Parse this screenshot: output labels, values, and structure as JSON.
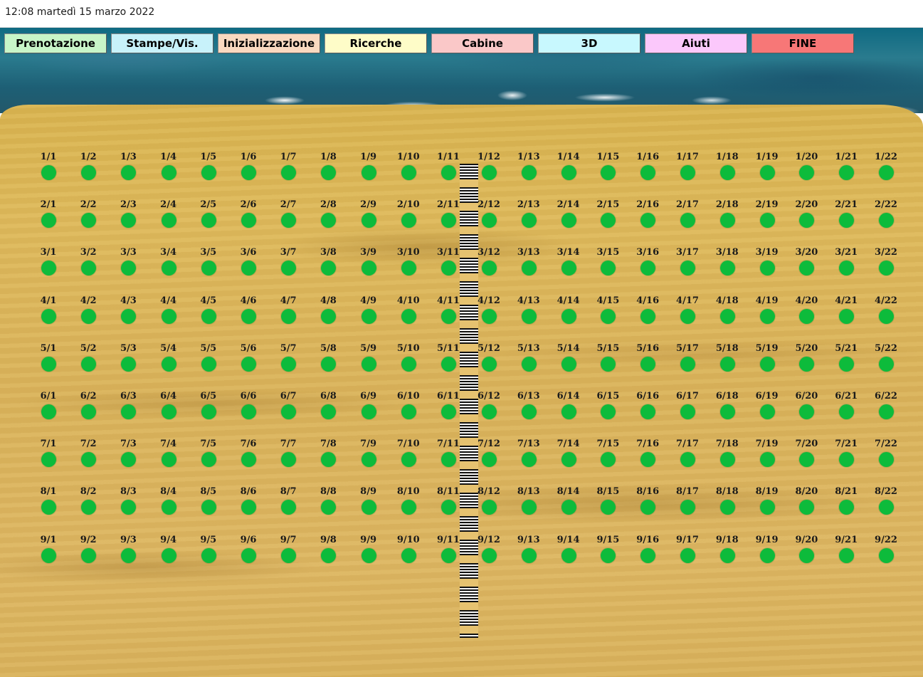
{
  "window": {
    "title": "12:08 martedì 15 marzo 2022"
  },
  "menu": [
    {
      "id": "prenotazione",
      "label": "Prenotazione",
      "color": "#c8f5c8"
    },
    {
      "id": "stampe",
      "label": "Stampe/Vis.",
      "color": "#c8f2fa"
    },
    {
      "id": "inizializzazione",
      "label": "Inizializzazione",
      "color": "#f9d9c0"
    },
    {
      "id": "ricerche",
      "label": "Ricerche",
      "color": "#fefcc8"
    },
    {
      "id": "cabine",
      "label": "Cabine",
      "color": "#fac8c8"
    },
    {
      "id": "3d",
      "label": "3D",
      "color": "#c8f8fe"
    },
    {
      "id": "aiuti",
      "label": "Aiuti",
      "color": "#fbc8fb"
    },
    {
      "id": "fine",
      "label": "FINE",
      "color": "#f77777"
    }
  ],
  "beach": {
    "rows": 9,
    "cols": 22,
    "spot_color": "#0dbb3b",
    "spots": [
      [
        "1/1",
        "1/2",
        "1/3",
        "1/4",
        "1/5",
        "1/6",
        "1/7",
        "1/8",
        "1/9",
        "1/10",
        "1/11",
        "1/12",
        "1/13",
        "1/14",
        "1/15",
        "1/16",
        "1/17",
        "1/18",
        "1/19",
        "1/20",
        "1/21",
        "1/22"
      ],
      [
        "2/1",
        "2/2",
        "2/3",
        "2/4",
        "2/5",
        "2/6",
        "2/7",
        "2/8",
        "2/9",
        "2/10",
        "2/11",
        "2/12",
        "2/13",
        "2/14",
        "2/15",
        "2/16",
        "2/17",
        "2/18",
        "2/19",
        "2/20",
        "2/21",
        "2/22"
      ],
      [
        "3/1",
        "3/2",
        "3/3",
        "3/4",
        "3/5",
        "3/6",
        "3/7",
        "3/8",
        "3/9",
        "3/10",
        "3/11",
        "3/12",
        "3/13",
        "3/14",
        "3/15",
        "3/16",
        "3/17",
        "3/18",
        "3/19",
        "3/20",
        "3/21",
        "3/22"
      ],
      [
        "4/1",
        "4/2",
        "4/3",
        "4/4",
        "4/5",
        "4/6",
        "4/7",
        "4/8",
        "4/9",
        "4/10",
        "4/11",
        "4/12",
        "4/13",
        "4/14",
        "4/15",
        "4/16",
        "4/17",
        "4/18",
        "4/19",
        "4/20",
        "4/21",
        "4/22"
      ],
      [
        "5/1",
        "5/2",
        "5/3",
        "5/4",
        "5/5",
        "5/6",
        "5/7",
        "5/8",
        "5/9",
        "5/10",
        "5/11",
        "5/12",
        "5/13",
        "5/14",
        "5/15",
        "5/16",
        "5/17",
        "5/18",
        "5/19",
        "5/20",
        "5/21",
        "5/22"
      ],
      [
        "6/1",
        "6/2",
        "6/3",
        "6/4",
        "6/5",
        "6/6",
        "6/7",
        "6/8",
        "6/9",
        "6/10",
        "6/11",
        "6/12",
        "6/13",
        "6/14",
        "6/15",
        "6/16",
        "6/17",
        "6/18",
        "6/19",
        "6/20",
        "6/21",
        "6/22"
      ],
      [
        "7/1",
        "7/2",
        "7/3",
        "7/4",
        "7/5",
        "7/6",
        "7/7",
        "7/8",
        "7/9",
        "7/10",
        "7/11",
        "7/12",
        "7/13",
        "7/14",
        "7/15",
        "7/16",
        "7/17",
        "7/18",
        "7/19",
        "7/20",
        "7/21",
        "7/22"
      ],
      [
        "8/1",
        "8/2",
        "8/3",
        "8/4",
        "8/5",
        "8/6",
        "8/7",
        "8/8",
        "8/9",
        "8/10",
        "8/11",
        "8/12",
        "8/13",
        "8/14",
        "8/15",
        "8/16",
        "8/17",
        "8/18",
        "8/19",
        "8/20",
        "8/21",
        "8/22"
      ],
      [
        "9/1",
        "9/2",
        "9/3",
        "9/4",
        "9/5",
        "9/6",
        "9/7",
        "9/8",
        "9/9",
        "9/10",
        "9/11",
        "9/12",
        "9/13",
        "9/14",
        "9/15",
        "9/16",
        "9/17",
        "9/18",
        "9/19",
        "9/20",
        "9/21",
        "9/22"
      ]
    ]
  }
}
